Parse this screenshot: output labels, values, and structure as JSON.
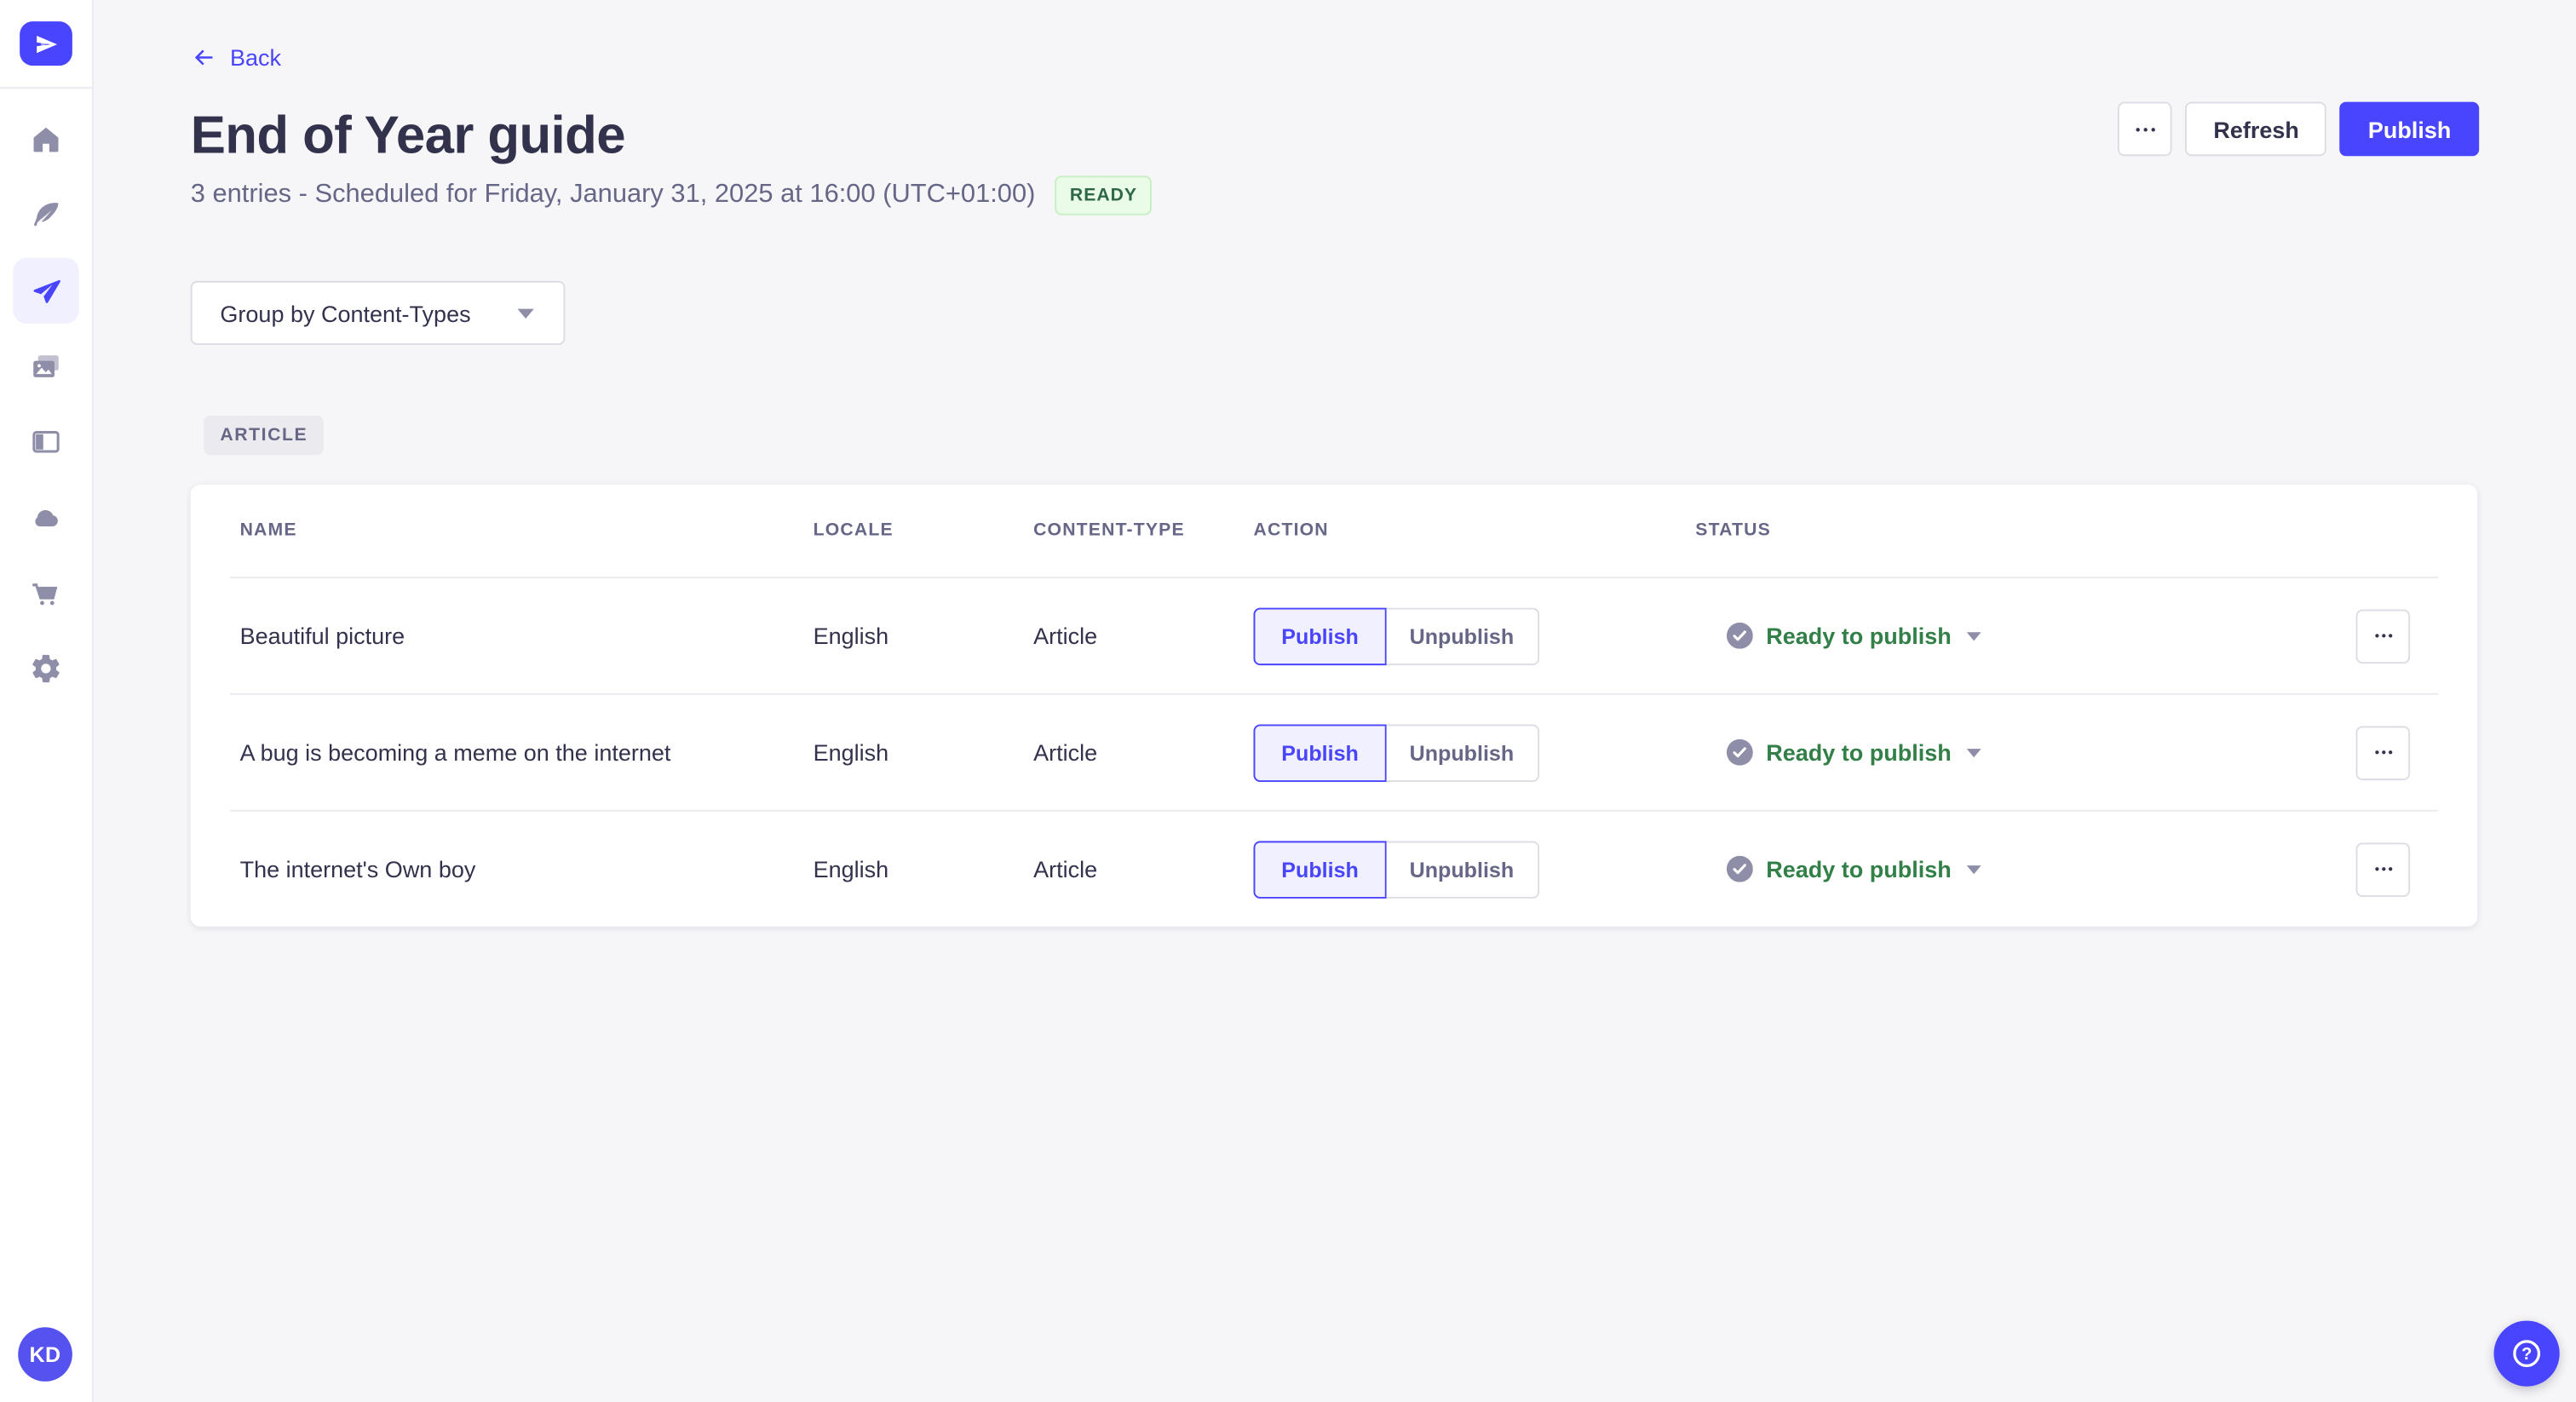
{
  "colors": {
    "primary": "#4945FF",
    "primary_light_bg": "#F0F0FF",
    "page_bg": "#F6F6F9",
    "card_bg": "#FFFFFF",
    "border_subtle": "#EAEAEF",
    "border_input": "#DCDCE4",
    "text_dark": "#32324D",
    "text_muted": "#666687",
    "icon_gray": "#8E8EA9",
    "status_green": "#328048",
    "ready_badge_text": "#2F6846",
    "ready_badge_bg": "#EAFBE7",
    "ready_badge_border": "#C6F0C2"
  },
  "sidebar": {
    "avatar_initials": "KD",
    "items": [
      {
        "icon": "home-icon",
        "active": false
      },
      {
        "icon": "feather-icon",
        "active": false
      },
      {
        "icon": "paper-plane-icon",
        "active": true
      },
      {
        "icon": "media-library-icon",
        "active": false
      },
      {
        "icon": "layout-panel-icon",
        "active": false
      },
      {
        "icon": "cloud-icon",
        "active": false
      },
      {
        "icon": "shopping-cart-icon",
        "active": false
      },
      {
        "icon": "gear-icon",
        "active": false
      }
    ],
    "logo_icon": "strapi-logo"
  },
  "header": {
    "back": "Back",
    "back_icon": "back-arrow-icon",
    "title": "End of Year guide",
    "subtitle": "3 entries - Scheduled for Friday, January 31, 2025 at 16:00 (UTC+01:00)",
    "ready_badge": "READY",
    "more_icon": "ellipsis-icon",
    "refresh_label": "Refresh",
    "publish_label": "Publish"
  },
  "filters": {
    "group_by": "Group by Content-Types",
    "caret_icon": "chevron-down-icon"
  },
  "content": {
    "group_label": "ARTICLE"
  },
  "table": {
    "headers": {
      "name": "NAME",
      "locale": "LOCALE",
      "content_type": "CONTENT-TYPE",
      "action": "ACTION",
      "status": "STATUS"
    },
    "rows": [
      {
        "name": "Beautiful picture",
        "locale": "English",
        "content_type": "Article",
        "publish_label": "Publish",
        "unpublish_label": "Unpublish",
        "status": "Ready to publish"
      },
      {
        "name": "A bug is becoming a meme on the internet",
        "locale": "English",
        "content_type": "Article",
        "publish_label": "Publish",
        "unpublish_label": "Unpublish",
        "status": "Ready to publish"
      },
      {
        "name": "The internet's Own boy",
        "locale": "English",
        "content_type": "Article",
        "publish_label": "Publish",
        "unpublish_label": "Unpublish",
        "status": "Ready to publish"
      }
    ],
    "row_icons": [
      "check-circle-icon",
      "caret-down-icon",
      "ellipsis-icon"
    ]
  },
  "fab": {
    "help_label": "?",
    "icon": "question-circle-icon"
  }
}
